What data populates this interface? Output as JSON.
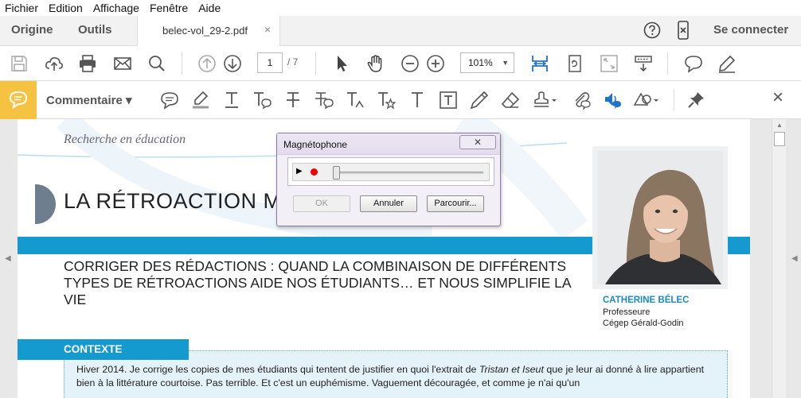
{
  "menubar": {
    "items": [
      "Fichier",
      "Edition",
      "Affichage",
      "Fenêtre",
      "Aide"
    ]
  },
  "tabs": {
    "home": "Origine",
    "tools": "Outils",
    "document": "belec-vol_29-2.pdf",
    "close": "×",
    "signin": "Se connecter"
  },
  "toolbar": {
    "page_current": "1",
    "page_total": "/ 7",
    "zoom": "101%",
    "zoom_arrow": "▼"
  },
  "comment_bar": {
    "label": "Commentaire",
    "dropdown": "▾",
    "close": "×"
  },
  "document": {
    "header": "Recherche en éducation",
    "title": "LA RÉTROACTION MU",
    "subtitle": "CORRIGER DES RÉDACTIONS : QUAND LA COMBINAISON DE DIFFÉRENTS TYPES DE RÉTROACTIONS AIDE NOS ÉTUDIANTS… ET NOUS SIMPLIFIE LA VIE",
    "author": {
      "name": "CATHERINE BÉLEC",
      "role": "Professeure",
      "place": "Cégep Gérald-Godin"
    },
    "context_title": "CONTEXTE",
    "context_text_1": "Hiver 2014. Je corrige les copies de mes étudiants qui tentent de justifier en quoi l'extrait de ",
    "context_text_italic": "Tristan et Iseut",
    "context_text_2": " que je leur ai donné à lire appartient bien à la littérature courtoise. Pas terrible. Et c'est un euphémisme. Vaguement découragée, et comme je n'ai qu'un"
  },
  "dialog": {
    "title": "Magnétophone",
    "close": "✕",
    "ok": "OK",
    "cancel": "Annuler",
    "browse": "Parcourir..."
  },
  "colors": {
    "accent_blue": "#159ad0",
    "comment_yellow": "#f5c242",
    "dialog_frame": "#8a7aa0"
  }
}
